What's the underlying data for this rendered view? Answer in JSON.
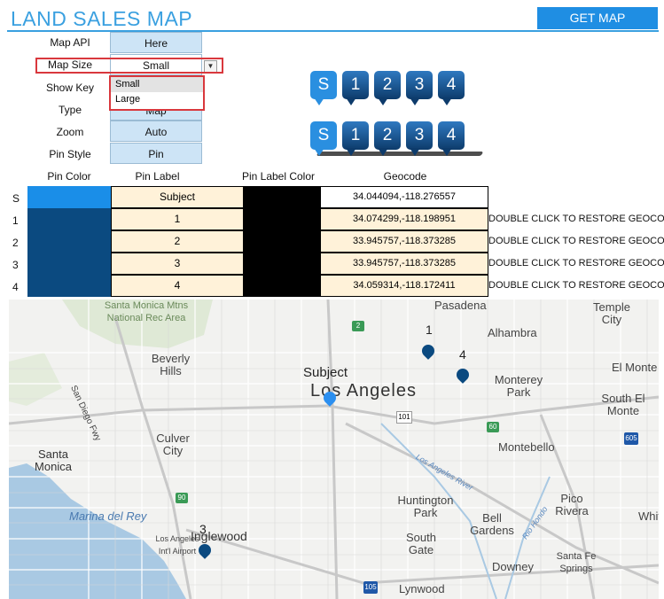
{
  "header": {
    "title": "LAND SALES MAP",
    "get_map_label": "GET MAP"
  },
  "settings": [
    {
      "label": "Map API",
      "value": "Here"
    },
    {
      "label": "Map Size",
      "value": "Small"
    },
    {
      "label": "Show Key",
      "value": ""
    },
    {
      "label": "Type",
      "value": "Map"
    },
    {
      "label": "Zoom",
      "value": "Auto"
    },
    {
      "label": "Pin Style",
      "value": "Pin"
    }
  ],
  "dropdown": {
    "options": [
      "Small",
      "Large"
    ]
  },
  "preview": {
    "row1": [
      "S",
      "1",
      "2",
      "3",
      "4"
    ],
    "row2": [
      "S",
      "1",
      "2",
      "3",
      "4"
    ]
  },
  "table": {
    "headers": {
      "pin_color": "Pin Color",
      "pin_label": "Pin Label",
      "pin_label_color": "Pin Label Color",
      "geocode": "Geocode"
    },
    "rows": [
      {
        "id": "S",
        "label": "Subject",
        "geocode": "34.044094,-118.276557",
        "note": "",
        "pin_color": "#1a8ee8"
      },
      {
        "id": "1",
        "label": "1",
        "geocode": "34.074299,-118.198951",
        "note": "DOUBLE CLICK TO RESTORE GEOCODE",
        "pin_color": "#0b4a80"
      },
      {
        "id": "2",
        "label": "2",
        "geocode": "33.945757,-118.373285",
        "note": "DOUBLE CLICK TO RESTORE GEOCODE",
        "pin_color": "#0b4a80"
      },
      {
        "id": "3",
        "label": "3",
        "geocode": "33.945757,-118.373285",
        "note": "DOUBLE CLICK TO RESTORE GEOCODE",
        "pin_color": "#0b4a80"
      },
      {
        "id": "4",
        "label": "4",
        "geocode": "34.059314,-118.172411",
        "note": "DOUBLE CLICK TO RESTORE GEOCODE",
        "pin_color": "#0b4a80"
      }
    ]
  },
  "map": {
    "places": [
      "Santa Monica Mtns National Rec Area",
      "Pasadena",
      "Temple City",
      "Alhambra",
      "Beverly Hills",
      "San Diego Fwy",
      "Los Angeles",
      "Monterey Park",
      "El Monte",
      "South El Monte",
      "Culver City",
      "Santa Monica",
      "Marina del Rey",
      "Montebello",
      "Huntington Park",
      "Bell Gardens",
      "Pico Rivera",
      "Whittier",
      "Inglewood",
      "Los Angeles Int'l Airport",
      "South Gate",
      "Downey",
      "Santa Fe Springs",
      "Lynwood",
      "Los Angeles River",
      "Rio Hondo"
    ],
    "pins": [
      "Subject",
      "1",
      "3",
      "4"
    ],
    "road_shields": [
      "2",
      "101",
      "60",
      "605",
      "105",
      "90"
    ],
    "colors": {
      "subject_pin": "#2b8ff0",
      "comp_pin": "#0b4a80",
      "water": "#a9c9e3"
    }
  }
}
